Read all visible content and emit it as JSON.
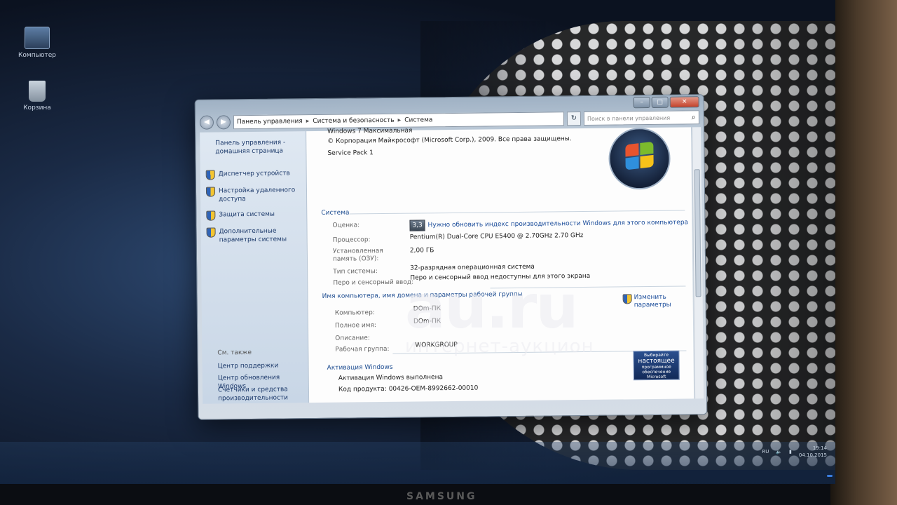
{
  "desktop": {
    "icons": [
      {
        "label": "Компьютер",
        "icon": "computer-icon"
      },
      {
        "label": "Корзина",
        "icon": "recycle-bin-icon"
      }
    ]
  },
  "window": {
    "controls": {
      "minimize": "–",
      "maximize": "□",
      "close": "✕"
    },
    "nav": {
      "back": "◀",
      "forward": "▶"
    },
    "address": {
      "crumbs": [
        "Панель управления",
        "Система и безопасность",
        "Система"
      ],
      "separator": "▸"
    },
    "refresh": "↻",
    "search_placeholder": "Поиск в панели управления",
    "search_icon": "⌕"
  },
  "sidebar": {
    "home_label": "Панель управления - домашняя страница",
    "tasks": [
      {
        "label": "Диспетчер устройств",
        "icon": "shield-icon"
      },
      {
        "label": "Настройка удаленного доступа",
        "icon": "shield-icon"
      },
      {
        "label": "Защита системы",
        "icon": "shield-icon"
      },
      {
        "label": "Дополнительные параметры системы",
        "icon": "shield-icon"
      }
    ],
    "see_also": "См. также",
    "links": [
      "Центр поддержки",
      "Центр обновления Windows",
      "Счетчики и средства производительности"
    ]
  },
  "edition": {
    "name": "Windows 7 Максимальная",
    "copyright": "© Корпорация Майкрософт (Microsoft Corp.), 2009. Все права защищены.",
    "service_pack": "Service Pack 1"
  },
  "system": {
    "heading": "Система",
    "rating_label": "Оценка:",
    "rating_value": "3,3",
    "rating_link": "Нужно обновить индекс производительности Windows для этого компьютера",
    "processor_label": "Процессор:",
    "processor_value": "Pentium(R) Dual-Core  CPU      E5400  @ 2.70GHz   2.70 GHz",
    "ram_label": "Установленная память (ОЗУ):",
    "ram_value": "2,00 ГБ",
    "type_label": "Тип системы:",
    "type_value": "32-разрядная операционная система",
    "pen_label": "Перо и сенсорный ввод:",
    "pen_value": "Перо и сенсорный ввод недоступны для этого экрана"
  },
  "computer_name": {
    "heading": "Имя компьютера, имя домена и параметры рабочей группы",
    "change_settings": "Изменить параметры",
    "computer_label": "Компьютер:",
    "computer_value": "DOm-ПК",
    "full_label": "Полное имя:",
    "full_value": "DOm-ПК",
    "description_label": "Описание:",
    "workgroup_label": "Рабочая группа:",
    "workgroup_value": "WORKGROUP"
  },
  "activation": {
    "heading": "Активация Windows",
    "status": "Активация Windows выполнена",
    "product_id": "Код продукта:  00426-OEM-8992662-00010",
    "genuine_top": "Выбирайте",
    "genuine_main": "настоящее",
    "genuine_sub": "программное обеспечение",
    "genuine_brand": "Microsoft"
  },
  "watermark": {
    "main": "au.ru",
    "sub": "интернет-аукцион"
  },
  "taskbar": {
    "lang": "RU",
    "time": "19:14",
    "date": "04.10.2015"
  },
  "monitor": {
    "brand": "SAMSUNG"
  }
}
